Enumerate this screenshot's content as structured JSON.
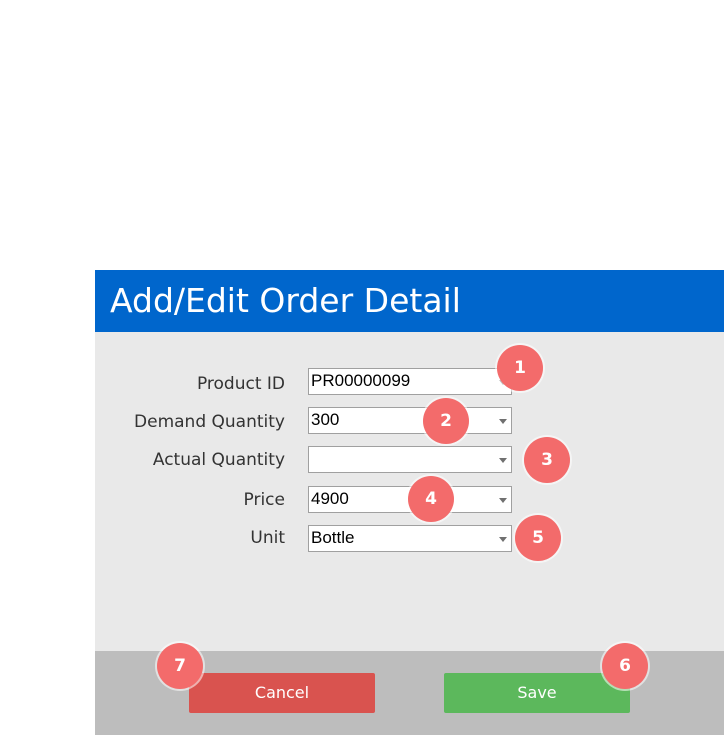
{
  "dialog": {
    "title": "Add/Edit Order Detail",
    "fields": [
      {
        "label": "Product ID",
        "value": "PR00000099"
      },
      {
        "label": "Demand Quantity",
        "value": "300"
      },
      {
        "label": "Actual Quantity",
        "value": ""
      },
      {
        "label": "Price",
        "value": "4900"
      },
      {
        "label": "Unit",
        "value": "Bottle"
      }
    ],
    "buttons": {
      "cancel": "Cancel",
      "save": "Save"
    }
  },
  "badges": [
    "1",
    "2",
    "3",
    "4",
    "5",
    "6",
    "7"
  ],
  "colors": {
    "title_bar": "#0066cc",
    "body": "#e9e9e9",
    "footer": "#bdbdbd",
    "cancel": "#d9534f",
    "save": "#5cb85c",
    "badge": "#f36b6b"
  }
}
